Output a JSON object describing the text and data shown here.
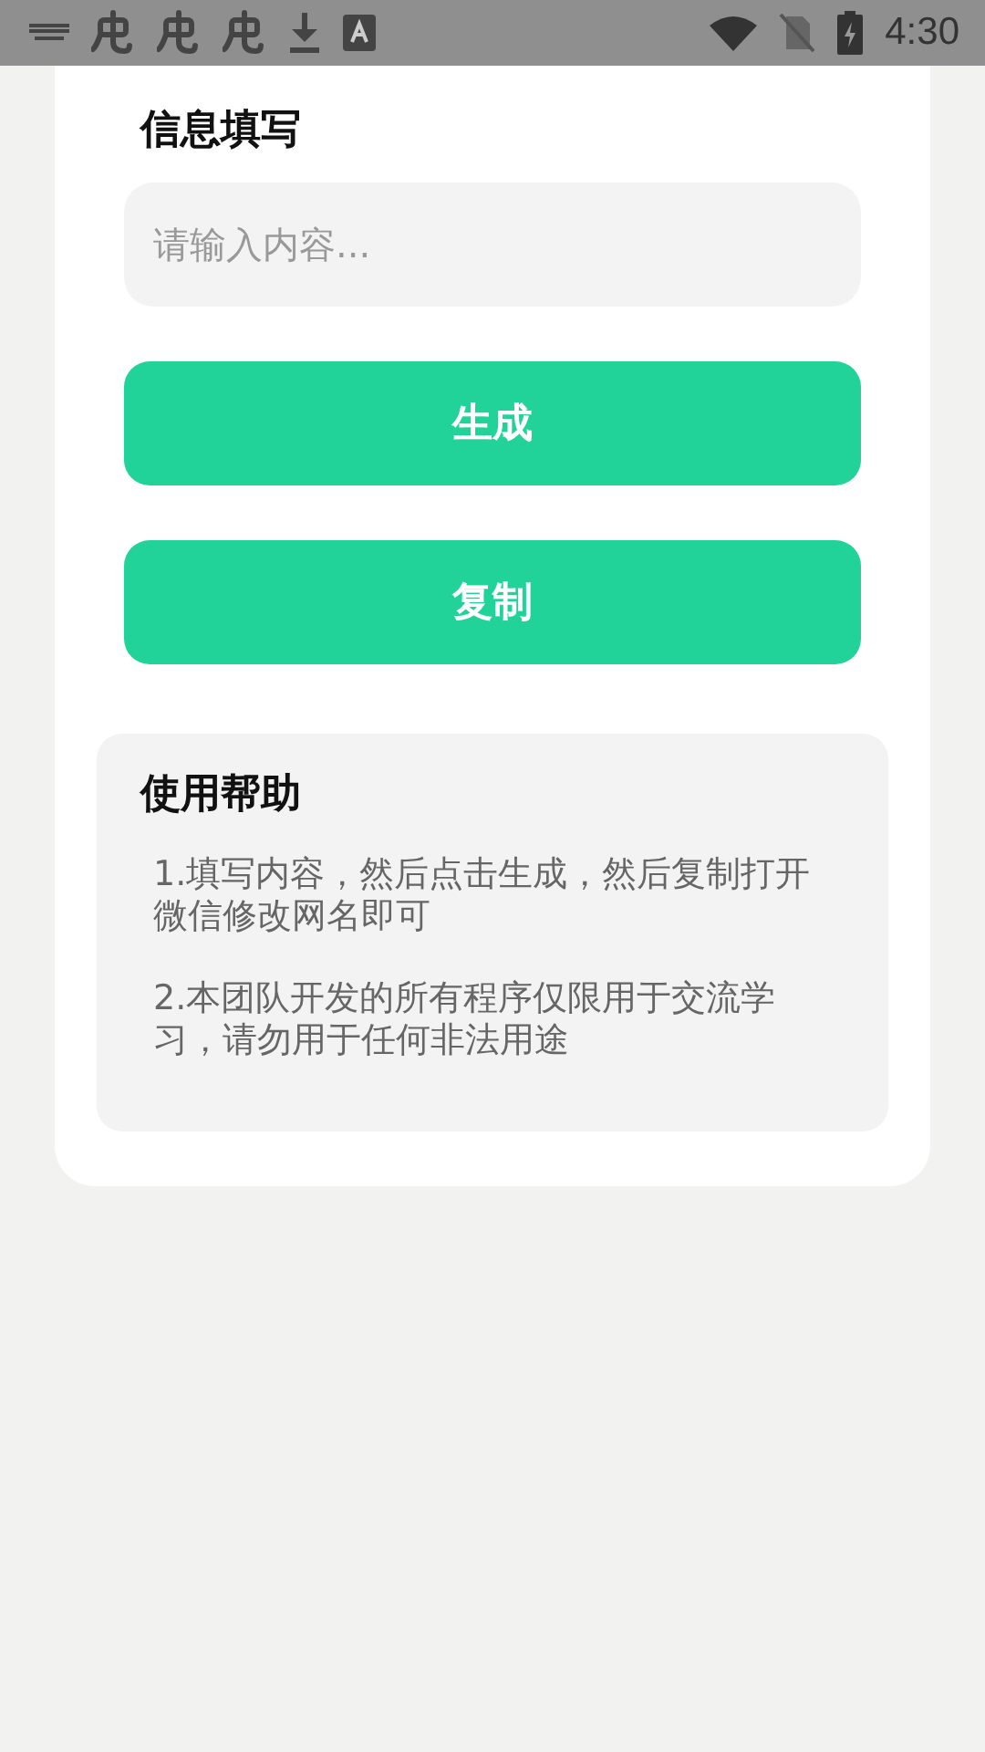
{
  "status_bar": {
    "time": "4:30"
  },
  "form": {
    "title": "信息填写",
    "input": {
      "placeholder": "请输入内容..."
    },
    "buttons": [
      "生成",
      "复制"
    ]
  },
  "help": {
    "title": "使用帮助",
    "items": [
      "1.填写内容，然后点击生成，然后复制打开微信修改网名即可",
      "2.本团队开发的所有程序仅限用于交流学习，请勿用于任何非法用途"
    ]
  }
}
